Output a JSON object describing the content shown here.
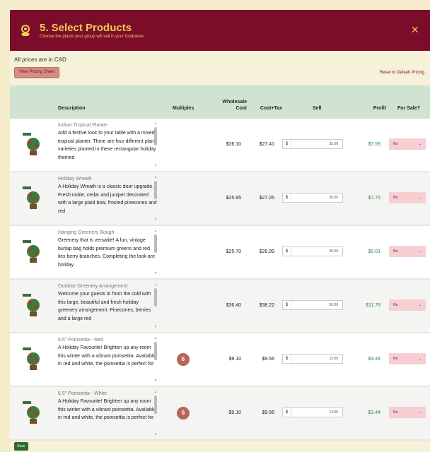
{
  "header": {
    "title": "5. Select Products",
    "subtitle": "Choose the plants your group will sell in your fundraiser",
    "close_label": "×"
  },
  "prices_note": "All prices are in CAD",
  "pricing_button": "View Pricing Sheet",
  "reset_link": "Reset to Default Pricing",
  "columns": {
    "description": "Description",
    "multiples": "Multiples",
    "wholesale": "Wholesale",
    "wholesale2": "Cost",
    "costtax": "Cost+Tax",
    "sell": "Sell",
    "profit": "Profit",
    "forsale": "For Sale?"
  },
  "rows": [
    {
      "name": "Indoor Tropical Planter",
      "text": "Add a festive look to your table with a mixed tropical planter. There are four different plant varieties planted in these rectangular holiday themed",
      "multiple": "",
      "wholesale": "$26.10",
      "costtax": "$27.41",
      "currency": "$",
      "sell": "35.00",
      "profit": "$7.59",
      "forsale": "No"
    },
    {
      "name": "Holiday Wreath",
      "text": "A Holiday Wreath is a classic door upgrade. Fresh noble, cedar and juniper decorated with a large plaid bow, frosted pinecones and red",
      "multiple": "",
      "wholesale": "$25.95",
      "costtax": "$27.25",
      "currency": "$",
      "sell": "35.00",
      "profit": "$7.75",
      "forsale": "No"
    },
    {
      "name": "Hanging Greenery Bough",
      "text": "Greenery that is versatile! A fun, vintage burlap bag holds premium greens and red ilex berry branches. Completing the look are holiday",
      "multiple": "",
      "wholesale": "$25.70",
      "costtax": "$26.99",
      "currency": "$",
      "sell": "35.00",
      "profit": "$8.01",
      "forsale": "No"
    },
    {
      "name": "Outdoor Greenery Arrangement",
      "text": "Welcome your guests in from the cold with this large, beautiful and fresh holiday greenery arrangement. Pinecones, berries and a large red",
      "multiple": "",
      "wholesale": "$36.40",
      "costtax": "$38.22",
      "currency": "$",
      "sell": "50.00",
      "profit": "$11.78",
      "forsale": "No"
    },
    {
      "name": "6.5\" Poinsettia - Red",
      "text": "A Holiday Favourite! Brighten up any room this winter with a vibrant poinsettia. Available in red and white, the poinsettia is perfect for",
      "multiple": "6",
      "wholesale": "$9.10",
      "costtax": "$9.56",
      "currency": "$",
      "sell": "13.00",
      "profit": "$3.44",
      "forsale": "No"
    },
    {
      "name": "6.5\" Poinsettia - White",
      "text": "A Holiday Favourite! Brighten up any room this winter with a vibrant poinsettia. Available in red and white, the poinsettia is perfect for",
      "multiple": "6",
      "wholesale": "$9.10",
      "costtax": "$9.56",
      "currency": "$",
      "sell": "13.00",
      "profit": "$3.44",
      "forsale": "No"
    }
  ],
  "save_button": "Save",
  "colors": {
    "header": "#7b0d2a",
    "accent": "#f0cb52",
    "profit": "#2f8c4f",
    "table_header": "#cfe3d0"
  },
  "icons": {
    "header": "plant-icon",
    "close": "close-icon",
    "dropdown": "chevron-down-icon"
  }
}
